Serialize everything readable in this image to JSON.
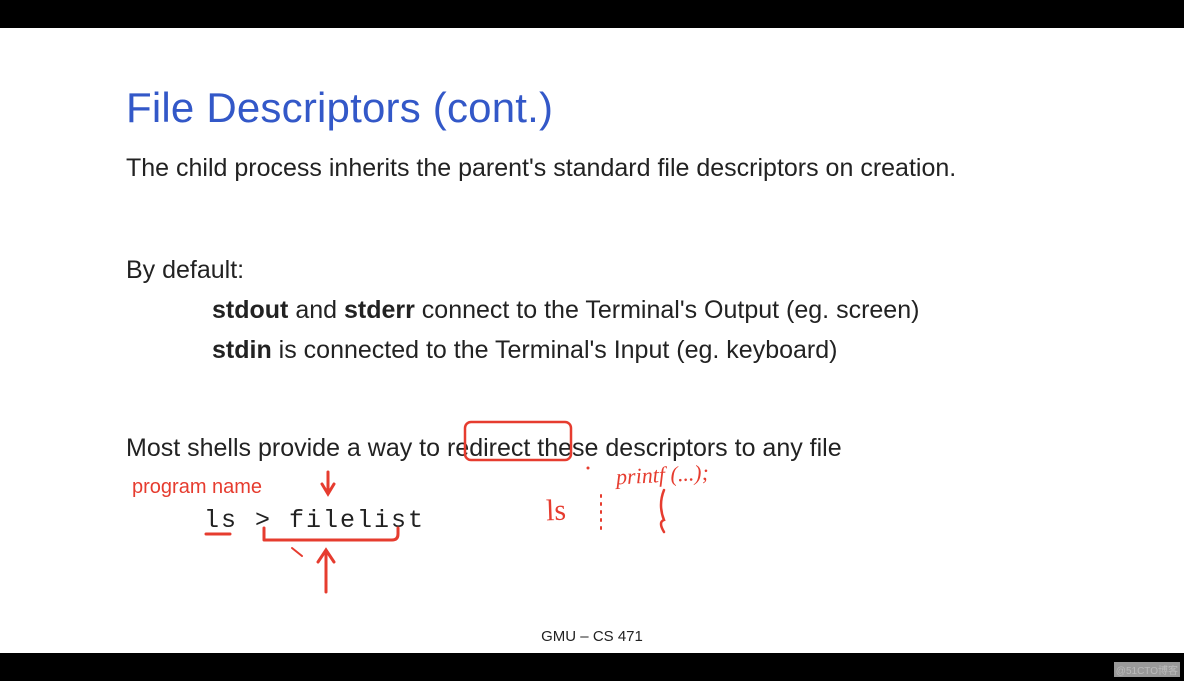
{
  "title": "File Descriptors (cont.)",
  "line1": "The child process inherits the parent's standard file descriptors on creation.",
  "line2": "By default:",
  "line3_pre": "stdout",
  "line3_mid": " and ",
  "line3_bold2": "stderr",
  "line3_post": " connect to the Terminal's Output (eg. screen)",
  "line4_pre": "stdin",
  "line4_post": " is connected to the Terminal's Input (eg. keyboard)",
  "line5_pre": "Most shells provide a way to ",
  "line5_boxed": "redirect",
  "line5_post": " these descriptors to any file",
  "hand_label": "program name",
  "code": "ls > filelist",
  "hand_ls": "ls",
  "hand_printf": "printf (...);",
  "footer": "GMU – CS 471",
  "watermark": "@51CTO博客"
}
